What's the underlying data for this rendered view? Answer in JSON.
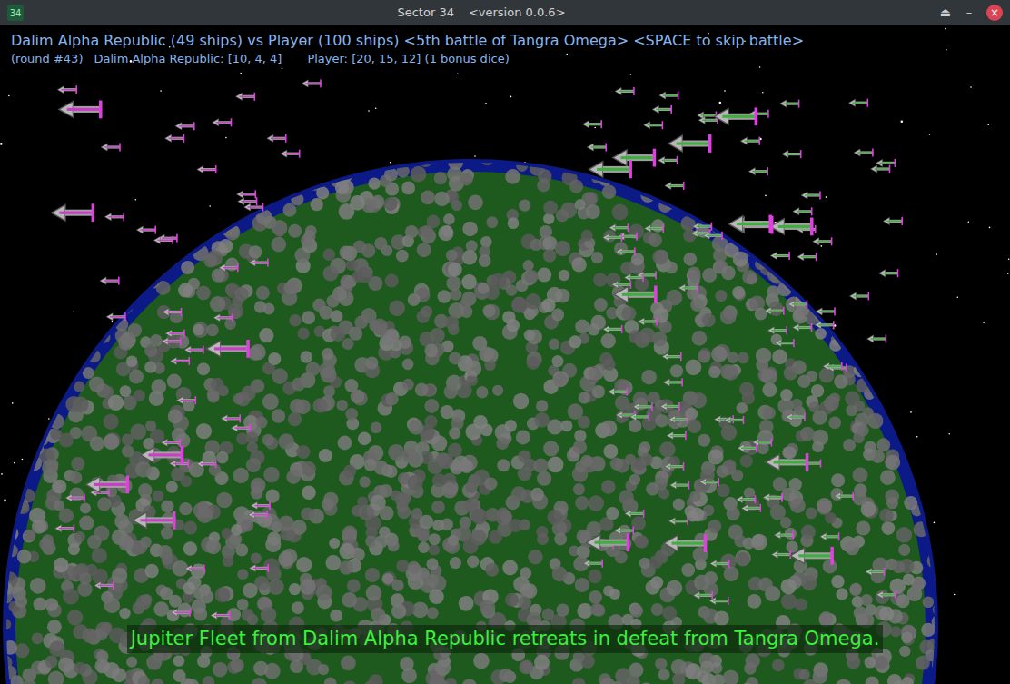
{
  "window": {
    "icon": "34",
    "title": "Sector 34",
    "version": "<version 0.0.6>",
    "buttons": [
      "⏏",
      "–",
      "×"
    ]
  },
  "battle": {
    "headline": "Dalim Alpha Republic (49 ships) vs Player (100 ships) <5th battle of Tangra Omega> <SPACE to skip battle>",
    "round": "(round #43)",
    "enemy_dice": "Dalim Alpha Republic: [10, 4, 4]",
    "player_dice": "Player: [20, 15, 12] (1 bonus dice)"
  },
  "fleets": [
    {
      "side": "Dalim Alpha Republic",
      "color": "#c93ec9",
      "small": 43,
      "large": 6
    },
    {
      "side": "Player",
      "color": "#3fae3f",
      "small": 88,
      "large": 12
    }
  ],
  "message": "Jupiter Fleet from Dalim Alpha Republic retreats in defeat from Tangra Omega."
}
